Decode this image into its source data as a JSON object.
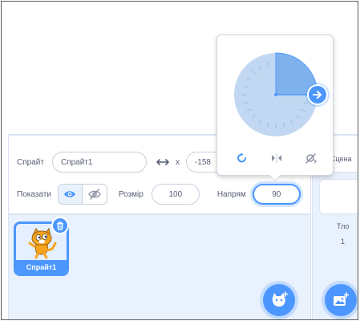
{
  "sprite_info": {
    "sprite_label": "Спрайт",
    "sprite_name": "Спрайт1",
    "x_label": "x",
    "x_value": "-158",
    "show_label": "Показати",
    "size_label": "Розмір",
    "size_value": "100",
    "direction_label": "Напрям",
    "direction_value": "90"
  },
  "sprite_list": {
    "items": [
      {
        "name": "Спрайт1",
        "selected": true
      }
    ]
  },
  "stage_panel": {
    "title": "Сцена",
    "backdrops_label": "Тло",
    "backdrops_count": "1"
  },
  "direction_popover": {
    "direction_degrees": 90,
    "modes": [
      "all-around-icon",
      "left-right-icon",
      "dont-rotate-icon"
    ]
  },
  "colors": {
    "accent": "#4c97ff",
    "dial": "#c2d8f2",
    "wedge": "#7fb2ec"
  }
}
